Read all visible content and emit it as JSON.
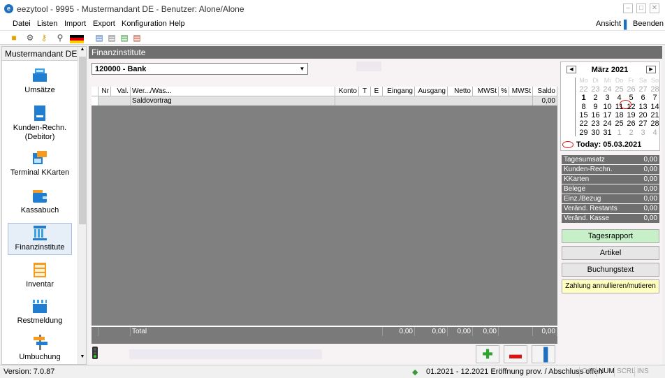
{
  "window": {
    "title": "eezytool - 9995 - Mustermandant DE - Benutzer: Alone/Alone",
    "app_icon": "e"
  },
  "menu": {
    "items": [
      "Datei",
      "Listen",
      "Import",
      "Export",
      "Konfiguration",
      "Help"
    ],
    "ansicht": "Ansicht",
    "beenden": "Beenden"
  },
  "sidebar": {
    "header": "Mustermandant DE",
    "items": [
      {
        "label": "Umsätze",
        "icon": "cash-register-icon"
      },
      {
        "label": "Kunden-Rechn. (Debitor)",
        "icon": "invoice-icon"
      },
      {
        "label": "Terminal KKarten",
        "icon": "card-terminal-icon"
      },
      {
        "label": "Kassabuch",
        "icon": "wallet-icon"
      },
      {
        "label": "Finanzinstitute",
        "icon": "bank-icon"
      },
      {
        "label": "Inventar",
        "icon": "shelf-icon"
      },
      {
        "label": "Restmeldung",
        "icon": "clapper-icon"
      },
      {
        "label": "Umbuchung",
        "icon": "signpost-icon"
      }
    ]
  },
  "main": {
    "header": "Finanzinstitute",
    "bank_select": "120000 - Bank",
    "columns": [
      "Nr",
      "Val.",
      "Wer.../Was...",
      "Konto",
      "T",
      "E",
      "Eingang",
      "Ausgang",
      "Netto",
      "MWSt",
      "%",
      "MWSt",
      "Saldo"
    ],
    "rows": [
      {
        "text": "Saldovortrag",
        "saldo": "0,00"
      }
    ],
    "footer": {
      "label": "Total",
      "eingang": "0,00",
      "ausgang": "0,00",
      "netto": "0,00",
      "mwst": "0,00",
      "saldo": "0,00"
    }
  },
  "calendar": {
    "title": "März 2021",
    "dow": [
      "Mo",
      "Di",
      "Mi",
      "Do",
      "Fr",
      "Sa",
      "So"
    ],
    "weeks": [
      [
        "22",
        "23",
        "24",
        "25",
        "26",
        "27",
        "28"
      ],
      [
        "1",
        "2",
        "3",
        "4",
        "5",
        "6",
        "7"
      ],
      [
        "8",
        "9",
        "10",
        "11",
        "12",
        "13",
        "14"
      ],
      [
        "15",
        "16",
        "17",
        "18",
        "19",
        "20",
        "21"
      ],
      [
        "22",
        "23",
        "24",
        "25",
        "26",
        "27",
        "28"
      ],
      [
        "29",
        "30",
        "31",
        "1",
        "2",
        "3",
        "4"
      ]
    ],
    "today_label": "Today: 05.03.2021"
  },
  "stats": [
    {
      "label": "Tagesumsatz",
      "value": "0,00"
    },
    {
      "label": "Kunden-Rechn.",
      "value": "0,00"
    },
    {
      "label": "KKarten",
      "value": "0,00"
    },
    {
      "label": "Belege",
      "value": "0,00"
    },
    {
      "label": "Einz./Bezug",
      "value": "0,00"
    },
    {
      "label": "Veränd. Restants",
      "value": "0,00"
    },
    {
      "label": "Veränd. Kasse",
      "value": "0,00"
    }
  ],
  "buttons": {
    "tagesrapport": "Tagesrapport",
    "artikel": "Artikel",
    "buchungstext": "Buchungstext",
    "zahlung": "Zahlung annullieren/mutieren"
  },
  "status": {
    "version": "Version: 7.0.87",
    "period": "01.2021 - 12.2021 Eröffnung prov. / Abschluss offen",
    "cap": "CAP",
    "num": "NUM",
    "scrl": "SCRL",
    "ins": "INS"
  },
  "colors": {
    "header_gray": "#6f6f6f",
    "grid_gray": "#808080",
    "green_btn": "#c8f0c8",
    "yellow_btn": "#ffffc0",
    "red": "#d11111"
  }
}
